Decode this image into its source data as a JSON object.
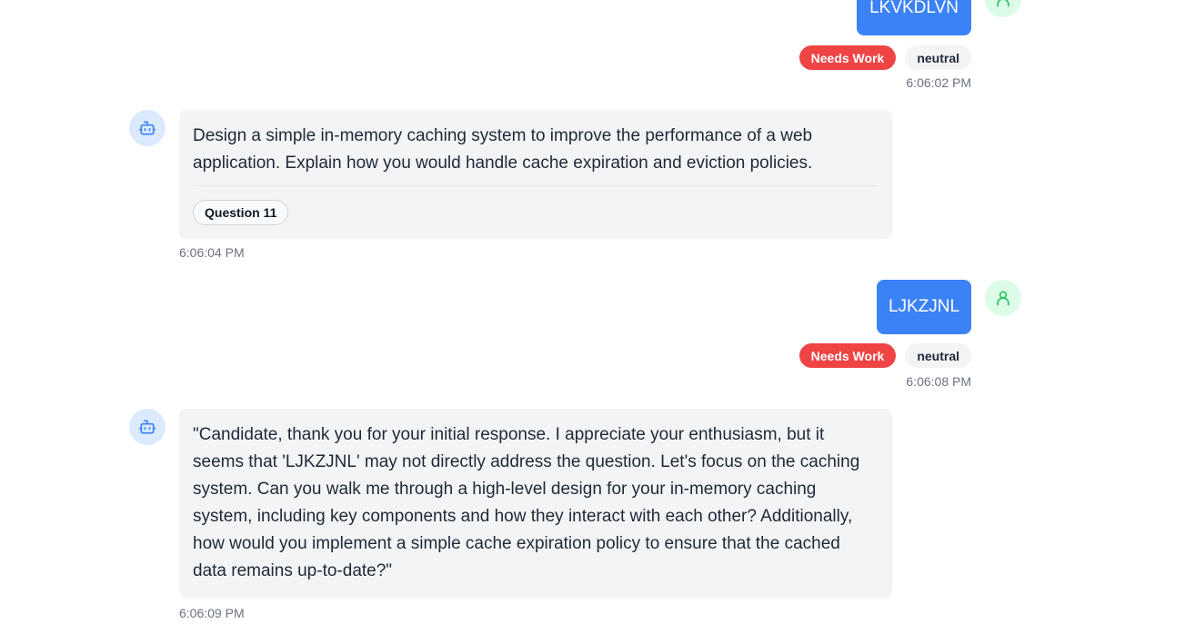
{
  "messages": {
    "m1": {
      "text": "LKVKDLVN",
      "tags": [
        "Needs Work",
        "neutral"
      ],
      "time": "6:06:02 PM"
    },
    "m2": {
      "text": "Design a simple in-memory caching system to improve the performance of a web application. Explain how you would handle cache expiration and eviction policies.",
      "question_label": "Question 11",
      "time": "6:06:04 PM"
    },
    "m3": {
      "text": "LJKZJNL",
      "tags": [
        "Needs Work",
        "neutral"
      ],
      "time": "6:06:08 PM"
    },
    "m4": {
      "text": "\"Candidate, thank you for your initial response. I appreciate your enthusiasm, but it seems that 'LJKZJNL' may not directly address the question. Let's focus on the caching system. Can you walk me through a high-level design for your in-memory caching system, including key components and how they interact with each other? Additionally, how would you implement a simple cache expiration policy to ensure that the cached data remains up-to-date?\"",
      "time": "6:06:09 PM"
    }
  },
  "colors": {
    "user_bubble": "#3b82f6",
    "needs_work": "#ef4444",
    "bot_avatar_bg": "#dbeafe",
    "user_avatar_bg": "#dcfce7"
  },
  "icons": {
    "bot": "bot-icon",
    "user": "user-icon"
  }
}
